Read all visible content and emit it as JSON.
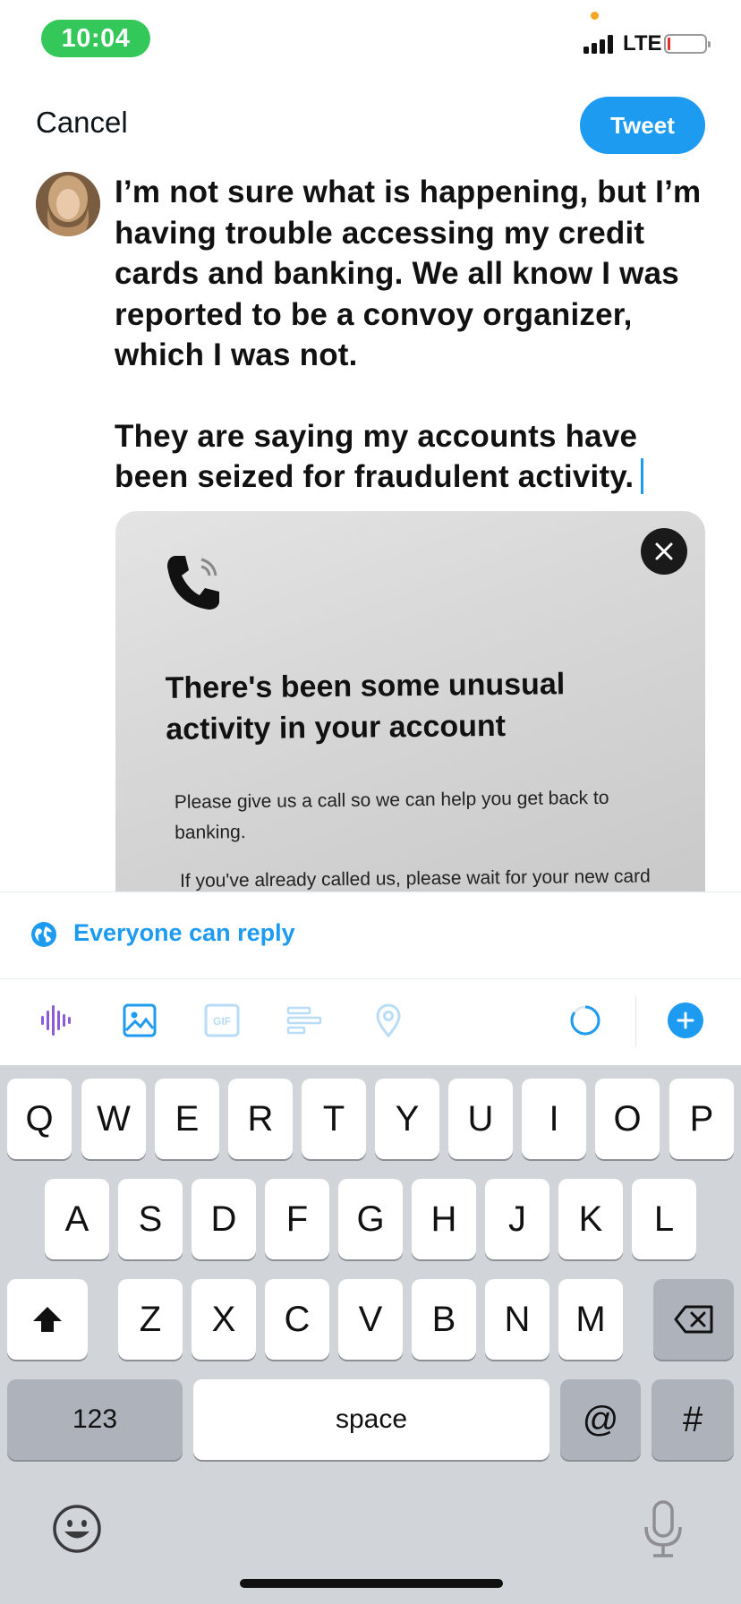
{
  "status_bar": {
    "time": "10:04",
    "network": "LTE",
    "colors": {
      "time_pill": "#34c759",
      "battery_low": "#e0302a",
      "privacy_dot": "#f5a623"
    }
  },
  "compose": {
    "cancel_label": "Cancel",
    "tweet_label": "Tweet",
    "paragraph1": "I’m not sure what is happening, but I’m having trouble accessing my credit cards and banking. We all know I was reported to be a convoy organizer, which I was not.",
    "paragraph2": "They are saying my accounts have been seized for fraudulent activity."
  },
  "media": {
    "headline": "There's been some unusual activity in your account",
    "body1": "Please give us a call so we can help you get back to banking.",
    "body2": "If you've already called us, please wait for your new card",
    "close_icon": "close-icon"
  },
  "reply_setting": {
    "label": "Everyone can reply",
    "icon": "globe-icon"
  },
  "toolbar": {
    "icons": [
      "voice-waveform-icon",
      "image-icon",
      "gif-icon",
      "poll-icon",
      "location-icon",
      "character-count-ring-icon",
      "add-thread-icon"
    ],
    "accent": "#1d9bf0"
  },
  "keyboard": {
    "row1": [
      "Q",
      "W",
      "E",
      "R",
      "T",
      "Y",
      "U",
      "I",
      "O",
      "P"
    ],
    "row2": [
      "A",
      "S",
      "D",
      "F",
      "G",
      "H",
      "J",
      "K",
      "L"
    ],
    "row3": [
      "Z",
      "X",
      "C",
      "V",
      "B",
      "N",
      "M"
    ],
    "numbers_label": "123",
    "space_label": "space",
    "at_label": "@",
    "hash_label": "#"
  }
}
